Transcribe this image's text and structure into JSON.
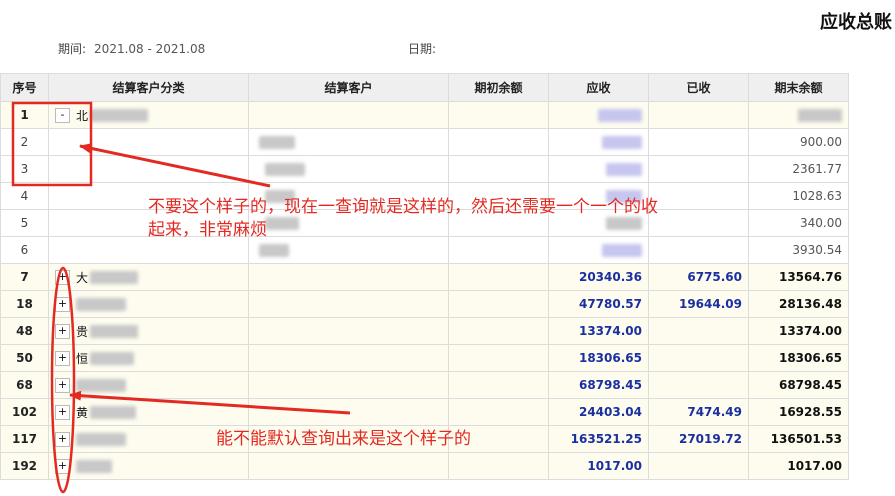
{
  "report": {
    "title": "应收总账",
    "period_label": "期间:",
    "period_value": "2021.08 - 2021.08",
    "date_label": "日期:"
  },
  "table": {
    "headers": [
      "序号",
      "结算客户分类",
      "结算客户",
      "期初余额",
      "应收",
      "已收",
      "期末余额"
    ],
    "rows": [
      {
        "seq": "1",
        "toggle": "-",
        "name_initial": "北",
        "opening": "",
        "receivable": "",
        "received": "",
        "closing": "",
        "expanded": true
      },
      {
        "seq": "2",
        "closing": "900.00"
      },
      {
        "seq": "3",
        "closing": "2361.77"
      },
      {
        "seq": "4",
        "closing": "1028.63"
      },
      {
        "seq": "5",
        "closing": "340.00"
      },
      {
        "seq": "6",
        "closing": "3930.54"
      },
      {
        "seq": "7",
        "toggle": "+",
        "name_initial": "大",
        "receivable": "20340.36",
        "received": "6775.60",
        "closing": "13564.76"
      },
      {
        "seq": "18",
        "toggle": "+",
        "name_initial": "",
        "receivable": "47780.57",
        "received": "19644.09",
        "closing": "28136.48"
      },
      {
        "seq": "48",
        "toggle": "+",
        "name_initial": "贵",
        "receivable": "13374.00",
        "received": "",
        "closing": "13374.00"
      },
      {
        "seq": "50",
        "toggle": "+",
        "name_initial": "恒",
        "receivable": "18306.65",
        "received": "",
        "closing": "18306.65"
      },
      {
        "seq": "68",
        "toggle": "+",
        "name_initial": "",
        "receivable": "68798.45",
        "received": "",
        "closing": "68798.45"
      },
      {
        "seq": "102",
        "toggle": "+",
        "name_initial": "黄",
        "receivable": "24403.04",
        "received": "7474.49",
        "closing": "16928.55"
      },
      {
        "seq": "117",
        "toggle": "+",
        "name_initial": "",
        "receivable": "163521.25",
        "received": "27019.72",
        "closing": "136501.53"
      },
      {
        "seq": "192",
        "toggle": "+",
        "name_initial": "",
        "receivable": "1017.00",
        "received": "",
        "closing": "1017.00"
      }
    ]
  },
  "annotations": {
    "note1_line1": "不要这个样子的，现在一查询就是这样的，然后还需要一个一个的收",
    "note1_line2": "起来，非常麻烦",
    "note2": "能不能默认查询出来是这个样子的",
    "color": "#e32a22"
  }
}
